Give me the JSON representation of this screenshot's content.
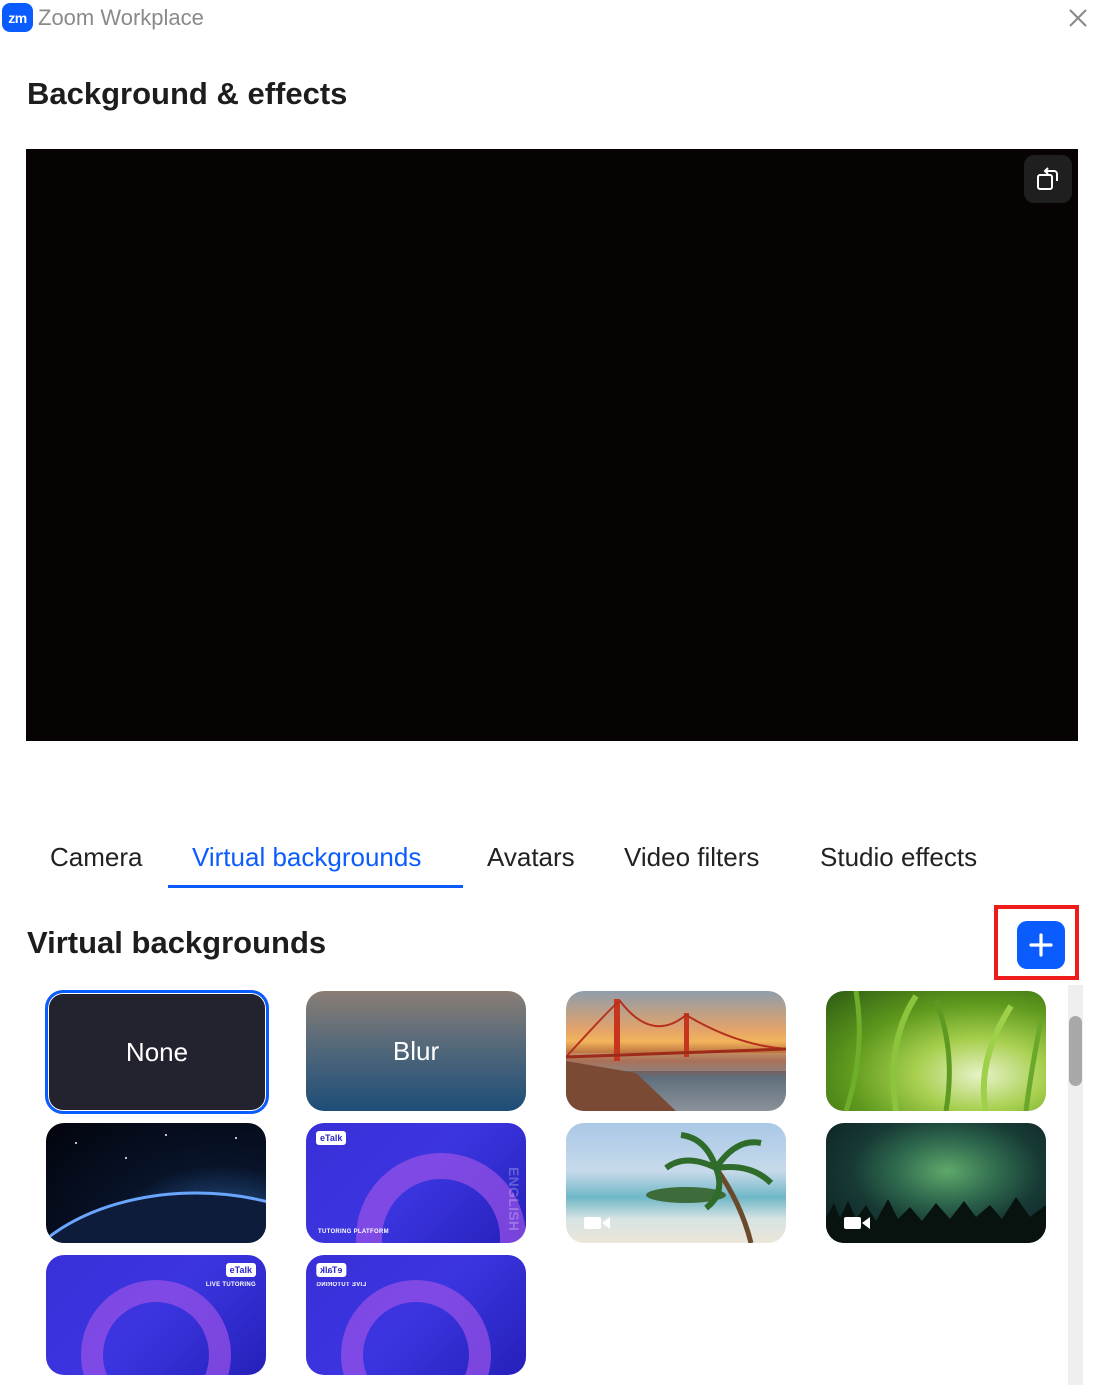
{
  "window": {
    "app_title": "Zoom Workplace",
    "logo_text": "zm",
    "brand_color": "#0b5cff"
  },
  "page": {
    "title": "Background & effects"
  },
  "preview": {
    "rotate_icon": "rotate-icon"
  },
  "tabs": [
    {
      "label": "Camera",
      "active": false
    },
    {
      "label": "Virtual backgrounds",
      "active": true
    },
    {
      "label": "Avatars",
      "active": false
    },
    {
      "label": "Video filters",
      "active": false
    },
    {
      "label": "Studio effects",
      "active": false
    }
  ],
  "section": {
    "title": "Virtual backgrounds",
    "add_icon": "plus-icon",
    "highlight_color": "#ee1b1b"
  },
  "backgrounds": [
    {
      "label": "None",
      "selected": true
    },
    {
      "label": "Blur",
      "selected": false
    },
    {
      "label": "",
      "image": "golden-gate-bridge"
    },
    {
      "label": "",
      "image": "grass"
    },
    {
      "label": "",
      "image": "earth-from-space"
    },
    {
      "label": "",
      "image": "etalk-tutoring-platform",
      "badge": "eTalk",
      "caption": "TUTORING PLATFORM",
      "side_text": "ENGLISH"
    },
    {
      "label": "",
      "image": "beach-palm",
      "video": true
    },
    {
      "label": "",
      "image": "aurora",
      "video": true
    },
    {
      "label": "",
      "image": "etalk-live-tutoring",
      "badge": "eTalk",
      "caption": "LIVE TUTORING"
    },
    {
      "label": "",
      "image": "etalk-live-tutoring-mirrored",
      "badge": "eTalk",
      "caption": "LIVE TUTORING"
    }
  ]
}
